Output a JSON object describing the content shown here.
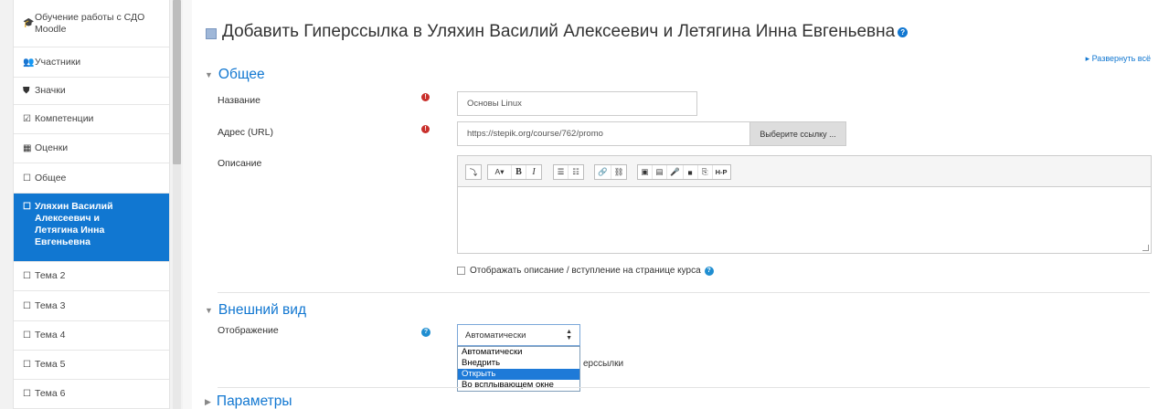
{
  "sidebar": {
    "items": [
      {
        "label": "Обучение работы с СДО Moodle",
        "icon": "graduation-cap-icon",
        "glyph": "🎓"
      },
      {
        "label": "Участники",
        "icon": "users-icon",
        "glyph": "👥"
      },
      {
        "label": "Значки",
        "icon": "shield-icon",
        "glyph": "⛊"
      },
      {
        "label": "Компетенции",
        "icon": "checkbox-icon",
        "glyph": "☑"
      },
      {
        "label": "Оценки",
        "icon": "table-icon",
        "glyph": "▦"
      },
      {
        "label": "Общее",
        "icon": "folder-icon",
        "glyph": "☐"
      },
      {
        "label": "Уляхин Василий Алексеевич и Летягина Инна Евгеньевна",
        "icon": "folder-icon",
        "glyph": "☐",
        "active": true
      },
      {
        "label": "Тема 2",
        "icon": "folder-icon",
        "glyph": "☐"
      },
      {
        "label": "Тема 3",
        "icon": "folder-icon",
        "glyph": "☐"
      },
      {
        "label": "Тема 4",
        "icon": "folder-icon",
        "glyph": "☐"
      },
      {
        "label": "Тема 5",
        "icon": "folder-icon",
        "glyph": "☐"
      },
      {
        "label": "Тема 6",
        "icon": "folder-icon",
        "glyph": "☐"
      }
    ]
  },
  "header": {
    "title": "Добавить Гиперссылка в Уляхин Василий Алексеевич и Летягина Инна Евгеньевна",
    "expand_all": "Развернуть всё"
  },
  "general": {
    "heading": "Общее",
    "name_label": "Название",
    "name_value": "Основы Linux",
    "url_label": "Адрес (URL)",
    "url_value": "https://stepik.org/course/762/promo",
    "url_button": "Выберите ссылку ...",
    "description_label": "Описание",
    "show_description": "Отображать описание / вступление на странице курса"
  },
  "editor": {
    "toolbar": [
      "⤵",
      "A▾",
      "B",
      "I",
      "☰",
      "☷",
      "🔗",
      "⛓",
      "▣",
      "▤",
      "🎤",
      "■",
      "⎘",
      "H-P"
    ]
  },
  "appearance": {
    "heading": "Внешний вид",
    "display_label": "Отображение",
    "display_value": "Автоматически",
    "options": [
      "Автоматически",
      "Внедрить",
      "Открыть",
      "Во всплывающем окне"
    ],
    "highlighted_option": "Открыть",
    "partial_text": "ерссылки"
  },
  "parameters": {
    "heading": "Параметры"
  },
  "colors": {
    "accent": "#1177d1",
    "required": "#c9302c"
  }
}
